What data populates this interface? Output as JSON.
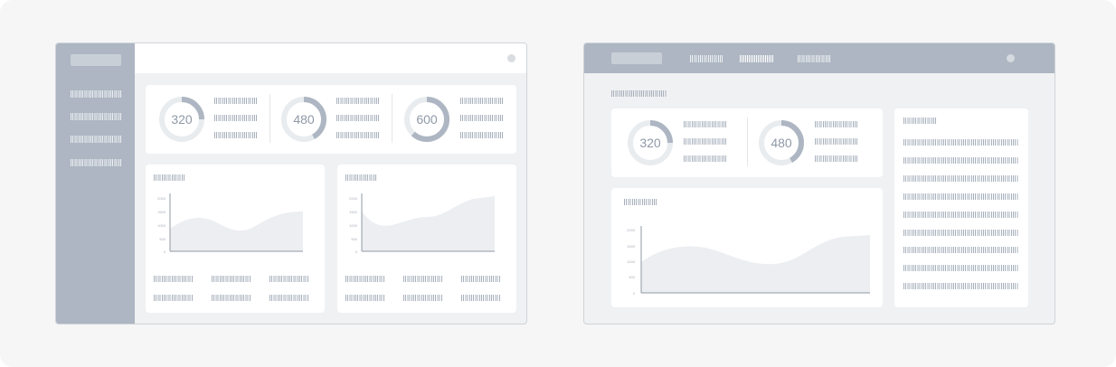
{
  "mockup_a": {
    "stats": [
      {
        "value": "320",
        "fraction": 0.25
      },
      {
        "value": "480",
        "fraction": 0.42
      },
      {
        "value": "600",
        "fraction": 0.62
      }
    ],
    "charts": [
      {
        "y_ticks": [
          "2000",
          "1500",
          "1000",
          "500",
          "0"
        ]
      },
      {
        "y_ticks": [
          "2000",
          "1500",
          "1000",
          "500",
          "0"
        ]
      }
    ]
  },
  "mockup_b": {
    "stats": [
      {
        "value": "320",
        "fraction": 0.25
      },
      {
        "value": "480",
        "fraction": 0.42
      }
    ],
    "chart": {
      "y_ticks": [
        "2000",
        "1500",
        "1000",
        "500",
        "0"
      ]
    }
  },
  "colors": {
    "nav_fill": "#adb6c2",
    "donut_track": "#e9ecef",
    "donut_fill": "#adb6c2",
    "area_fill": "#eceef1",
    "axis": "#8f99a6"
  }
}
